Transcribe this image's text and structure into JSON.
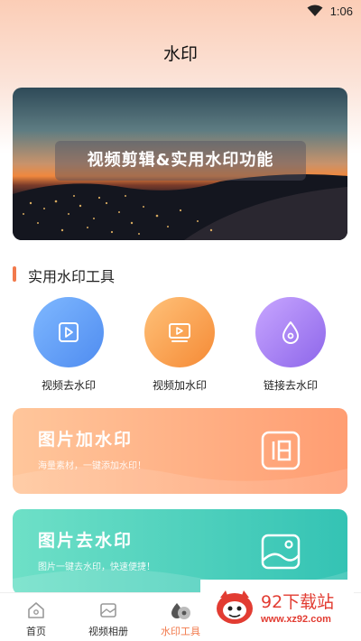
{
  "status_bar": {
    "time": "1:06"
  },
  "header": {
    "title": "水印"
  },
  "banner": {
    "caption": "视频剪辑&实用水印功能"
  },
  "section": {
    "title": "实用水印工具"
  },
  "tools": [
    {
      "label": "视频去水印",
      "icon": "play-square-icon",
      "color": "#5b95f2"
    },
    {
      "label": "视频加水印",
      "icon": "video-frame-icon",
      "color": "#f6913f"
    },
    {
      "label": "链接去水印",
      "icon": "water-drop-icon",
      "color": "#9a72ec"
    }
  ],
  "cards": {
    "add": {
      "title": "图片加水印",
      "subtitle": "海量素材，一键添加水印！",
      "icon": "stamp-icon"
    },
    "remove": {
      "title": "图片去水印",
      "subtitle": "图片一键去水印，快速便捷！",
      "icon": "image-icon"
    }
  },
  "tabbar": {
    "items": [
      {
        "label": "首页",
        "icon": "home-icon"
      },
      {
        "label": "视频相册",
        "icon": "photo-album-icon"
      },
      {
        "label": "水印工具",
        "icon": "watermark-tool-icon",
        "active": true
      }
    ]
  },
  "watermark_logo": {
    "name": "92下载站",
    "url": "www.xz92.com"
  },
  "colors": {
    "accent": "#f27a4c",
    "add_card": "#ffb085",
    "remove_card": "#4fd1bd"
  }
}
